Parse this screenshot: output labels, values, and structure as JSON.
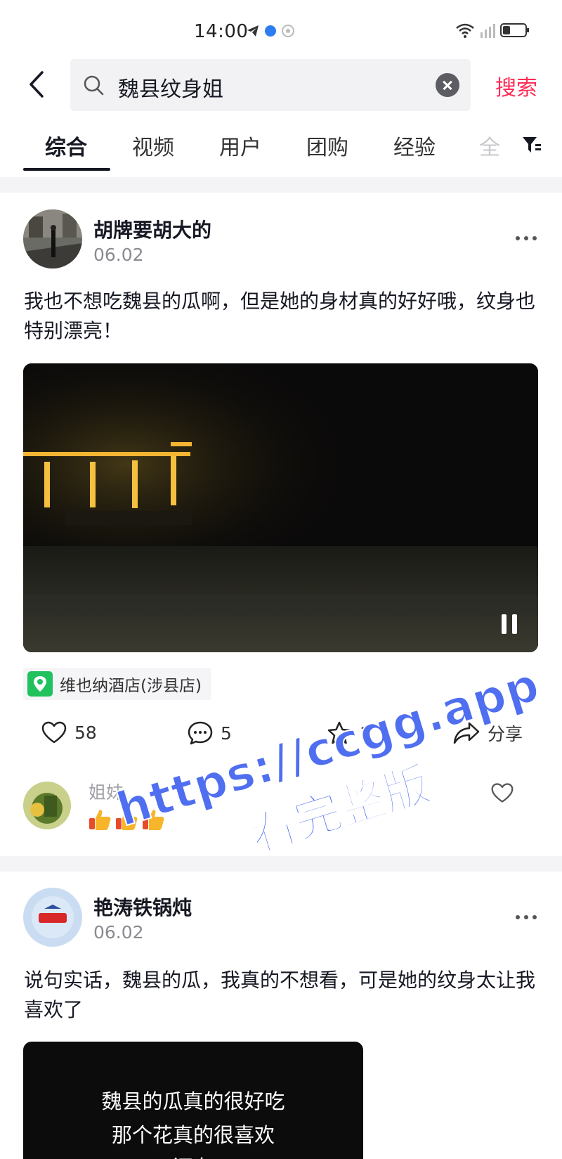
{
  "status_bar": {
    "time": "14:00"
  },
  "search": {
    "query": "魏县纹身姐",
    "button": "搜索"
  },
  "tabs": [
    {
      "label": "综合",
      "active": true
    },
    {
      "label": "视频"
    },
    {
      "label": "用户"
    },
    {
      "label": "团购"
    },
    {
      "label": "经验"
    },
    {
      "label": "全"
    }
  ],
  "posts": [
    {
      "username": "胡牌要胡大的",
      "date": "06.02",
      "text": "我也不想吃魏县的瓜啊，但是她的身材真的好好哦，纹身也特别漂亮！",
      "location": "维也纳酒店(涉县店)",
      "likes": "58",
      "comments": "5",
      "favorites": "1",
      "share": "分享",
      "top_comment": {
        "name": "姐妹",
        "emoji": "👍👍👍"
      }
    },
    {
      "username": "艳涛铁锅炖",
      "date": "06.02",
      "text": "说句实话，魏县的瓜，我真的不想看，可是她的纹身太让我喜欢了",
      "video_lines": [
        "魏县的瓜真的很好吃",
        "那个花真的很喜欢",
        "还有"
      ]
    }
  ],
  "watermark": {
    "line1": "https://ccgg.app",
    "line2": "看完整版"
  },
  "colors": {
    "accent": "#fe2c55",
    "watermark": "#4f6ef0",
    "location_pin": "#21c15e"
  }
}
